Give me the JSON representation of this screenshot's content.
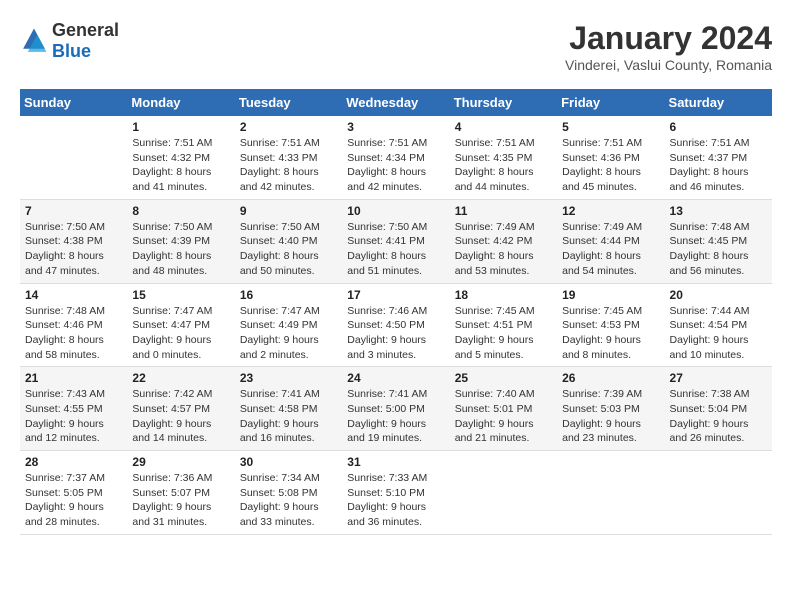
{
  "logo": {
    "general": "General",
    "blue": "Blue"
  },
  "header": {
    "month": "January 2024",
    "location": "Vinderei, Vaslui County, Romania"
  },
  "weekdays": [
    "Sunday",
    "Monday",
    "Tuesday",
    "Wednesday",
    "Thursday",
    "Friday",
    "Saturday"
  ],
  "weeks": [
    [
      {
        "day": "",
        "info": ""
      },
      {
        "day": "1",
        "info": "Sunrise: 7:51 AM\nSunset: 4:32 PM\nDaylight: 8 hours\nand 41 minutes."
      },
      {
        "day": "2",
        "info": "Sunrise: 7:51 AM\nSunset: 4:33 PM\nDaylight: 8 hours\nand 42 minutes."
      },
      {
        "day": "3",
        "info": "Sunrise: 7:51 AM\nSunset: 4:34 PM\nDaylight: 8 hours\nand 42 minutes."
      },
      {
        "day": "4",
        "info": "Sunrise: 7:51 AM\nSunset: 4:35 PM\nDaylight: 8 hours\nand 44 minutes."
      },
      {
        "day": "5",
        "info": "Sunrise: 7:51 AM\nSunset: 4:36 PM\nDaylight: 8 hours\nand 45 minutes."
      },
      {
        "day": "6",
        "info": "Sunrise: 7:51 AM\nSunset: 4:37 PM\nDaylight: 8 hours\nand 46 minutes."
      }
    ],
    [
      {
        "day": "7",
        "info": "Sunrise: 7:50 AM\nSunset: 4:38 PM\nDaylight: 8 hours\nand 47 minutes."
      },
      {
        "day": "8",
        "info": "Sunrise: 7:50 AM\nSunset: 4:39 PM\nDaylight: 8 hours\nand 48 minutes."
      },
      {
        "day": "9",
        "info": "Sunrise: 7:50 AM\nSunset: 4:40 PM\nDaylight: 8 hours\nand 50 minutes."
      },
      {
        "day": "10",
        "info": "Sunrise: 7:50 AM\nSunset: 4:41 PM\nDaylight: 8 hours\nand 51 minutes."
      },
      {
        "day": "11",
        "info": "Sunrise: 7:49 AM\nSunset: 4:42 PM\nDaylight: 8 hours\nand 53 minutes."
      },
      {
        "day": "12",
        "info": "Sunrise: 7:49 AM\nSunset: 4:44 PM\nDaylight: 8 hours\nand 54 minutes."
      },
      {
        "day": "13",
        "info": "Sunrise: 7:48 AM\nSunset: 4:45 PM\nDaylight: 8 hours\nand 56 minutes."
      }
    ],
    [
      {
        "day": "14",
        "info": "Sunrise: 7:48 AM\nSunset: 4:46 PM\nDaylight: 8 hours\nand 58 minutes."
      },
      {
        "day": "15",
        "info": "Sunrise: 7:47 AM\nSunset: 4:47 PM\nDaylight: 9 hours\nand 0 minutes."
      },
      {
        "day": "16",
        "info": "Sunrise: 7:47 AM\nSunset: 4:49 PM\nDaylight: 9 hours\nand 2 minutes."
      },
      {
        "day": "17",
        "info": "Sunrise: 7:46 AM\nSunset: 4:50 PM\nDaylight: 9 hours\nand 3 minutes."
      },
      {
        "day": "18",
        "info": "Sunrise: 7:45 AM\nSunset: 4:51 PM\nDaylight: 9 hours\nand 5 minutes."
      },
      {
        "day": "19",
        "info": "Sunrise: 7:45 AM\nSunset: 4:53 PM\nDaylight: 9 hours\nand 8 minutes."
      },
      {
        "day": "20",
        "info": "Sunrise: 7:44 AM\nSunset: 4:54 PM\nDaylight: 9 hours\nand 10 minutes."
      }
    ],
    [
      {
        "day": "21",
        "info": "Sunrise: 7:43 AM\nSunset: 4:55 PM\nDaylight: 9 hours\nand 12 minutes."
      },
      {
        "day": "22",
        "info": "Sunrise: 7:42 AM\nSunset: 4:57 PM\nDaylight: 9 hours\nand 14 minutes."
      },
      {
        "day": "23",
        "info": "Sunrise: 7:41 AM\nSunset: 4:58 PM\nDaylight: 9 hours\nand 16 minutes."
      },
      {
        "day": "24",
        "info": "Sunrise: 7:41 AM\nSunset: 5:00 PM\nDaylight: 9 hours\nand 19 minutes."
      },
      {
        "day": "25",
        "info": "Sunrise: 7:40 AM\nSunset: 5:01 PM\nDaylight: 9 hours\nand 21 minutes."
      },
      {
        "day": "26",
        "info": "Sunrise: 7:39 AM\nSunset: 5:03 PM\nDaylight: 9 hours\nand 23 minutes."
      },
      {
        "day": "27",
        "info": "Sunrise: 7:38 AM\nSunset: 5:04 PM\nDaylight: 9 hours\nand 26 minutes."
      }
    ],
    [
      {
        "day": "28",
        "info": "Sunrise: 7:37 AM\nSunset: 5:05 PM\nDaylight: 9 hours\nand 28 minutes."
      },
      {
        "day": "29",
        "info": "Sunrise: 7:36 AM\nSunset: 5:07 PM\nDaylight: 9 hours\nand 31 minutes."
      },
      {
        "day": "30",
        "info": "Sunrise: 7:34 AM\nSunset: 5:08 PM\nDaylight: 9 hours\nand 33 minutes."
      },
      {
        "day": "31",
        "info": "Sunrise: 7:33 AM\nSunset: 5:10 PM\nDaylight: 9 hours\nand 36 minutes."
      },
      {
        "day": "",
        "info": ""
      },
      {
        "day": "",
        "info": ""
      },
      {
        "day": "",
        "info": ""
      }
    ]
  ]
}
